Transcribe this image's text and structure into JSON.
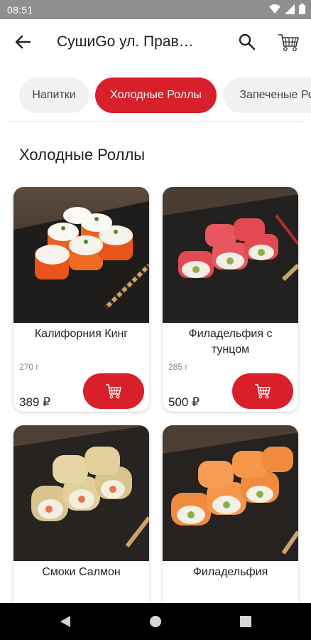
{
  "status": {
    "time": "08:51",
    "icons": [
      "wifi-icon",
      "signal-icon",
      "battery-icon"
    ]
  },
  "header": {
    "title": "СушиGo ул. Прав…",
    "icons": [
      "back-arrow-icon",
      "search-icon",
      "cart-icon"
    ]
  },
  "categories": [
    {
      "label": "Напитки",
      "active": false
    },
    {
      "label": "Холодные Роллы",
      "active": true
    },
    {
      "label": "Запеченые Роллы",
      "active": false
    }
  ],
  "section": {
    "title": "Холодные Роллы"
  },
  "products": [
    {
      "name": "Калифорния Кинг",
      "weight": "270 г",
      "price": "389 ₽"
    },
    {
      "name": "Филадельфия с тунцом",
      "weight": "285 г",
      "price": "500 ₽"
    },
    {
      "name": "Смоки Салмон"
    },
    {
      "name": "Филадельфия"
    }
  ],
  "colors": {
    "accent": "#d81f2a",
    "status_bar": "#8f8f8f",
    "nav_bar": "#000000"
  },
  "navbar": {
    "icons": [
      "back-triangle-icon",
      "home-circle-icon",
      "recents-square-icon"
    ]
  }
}
